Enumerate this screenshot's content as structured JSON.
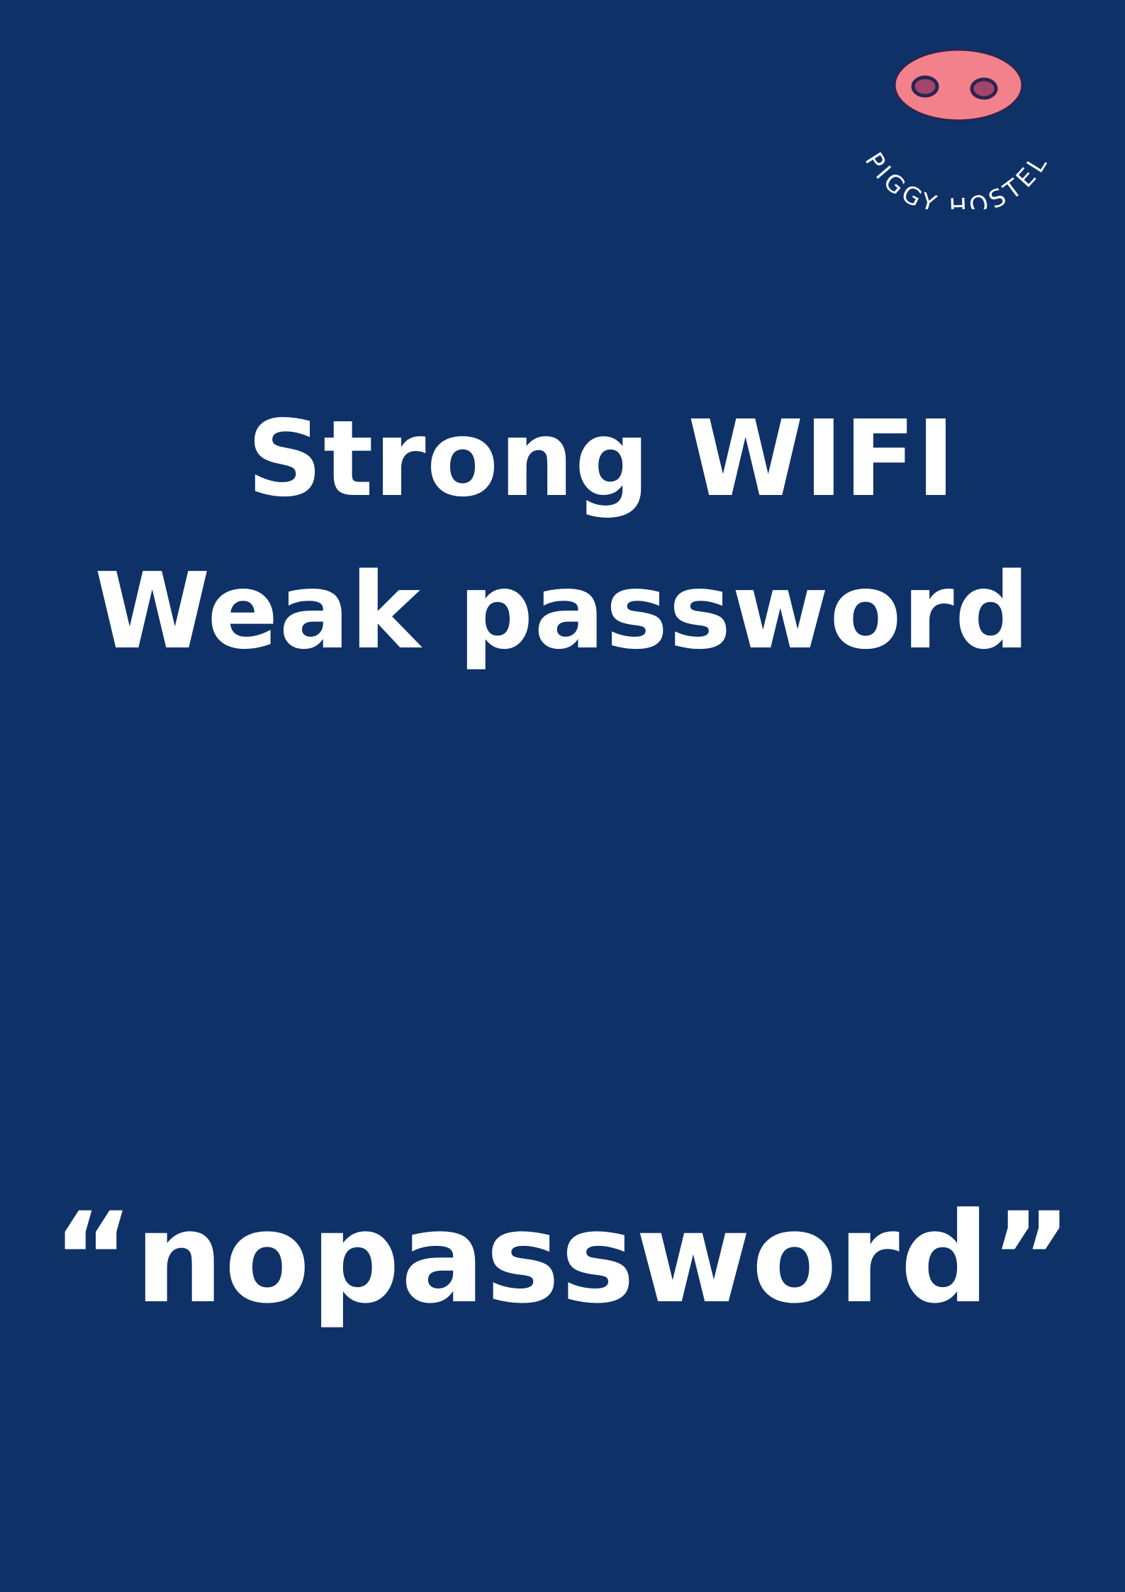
{
  "brand": {
    "name": "PIGGY HOSTEL",
    "logo_icon": "pig-snout-icon",
    "snout_color": "#f2818c",
    "nostril_color": "#a3456b",
    "outline_color": "#2a2550"
  },
  "colors": {
    "background": "#0e3268",
    "text": "#ffffff"
  },
  "headline": {
    "line1": "Strong WIFI",
    "line2": "Weak password"
  },
  "wifi": {
    "password_display": "“nopassword”"
  }
}
